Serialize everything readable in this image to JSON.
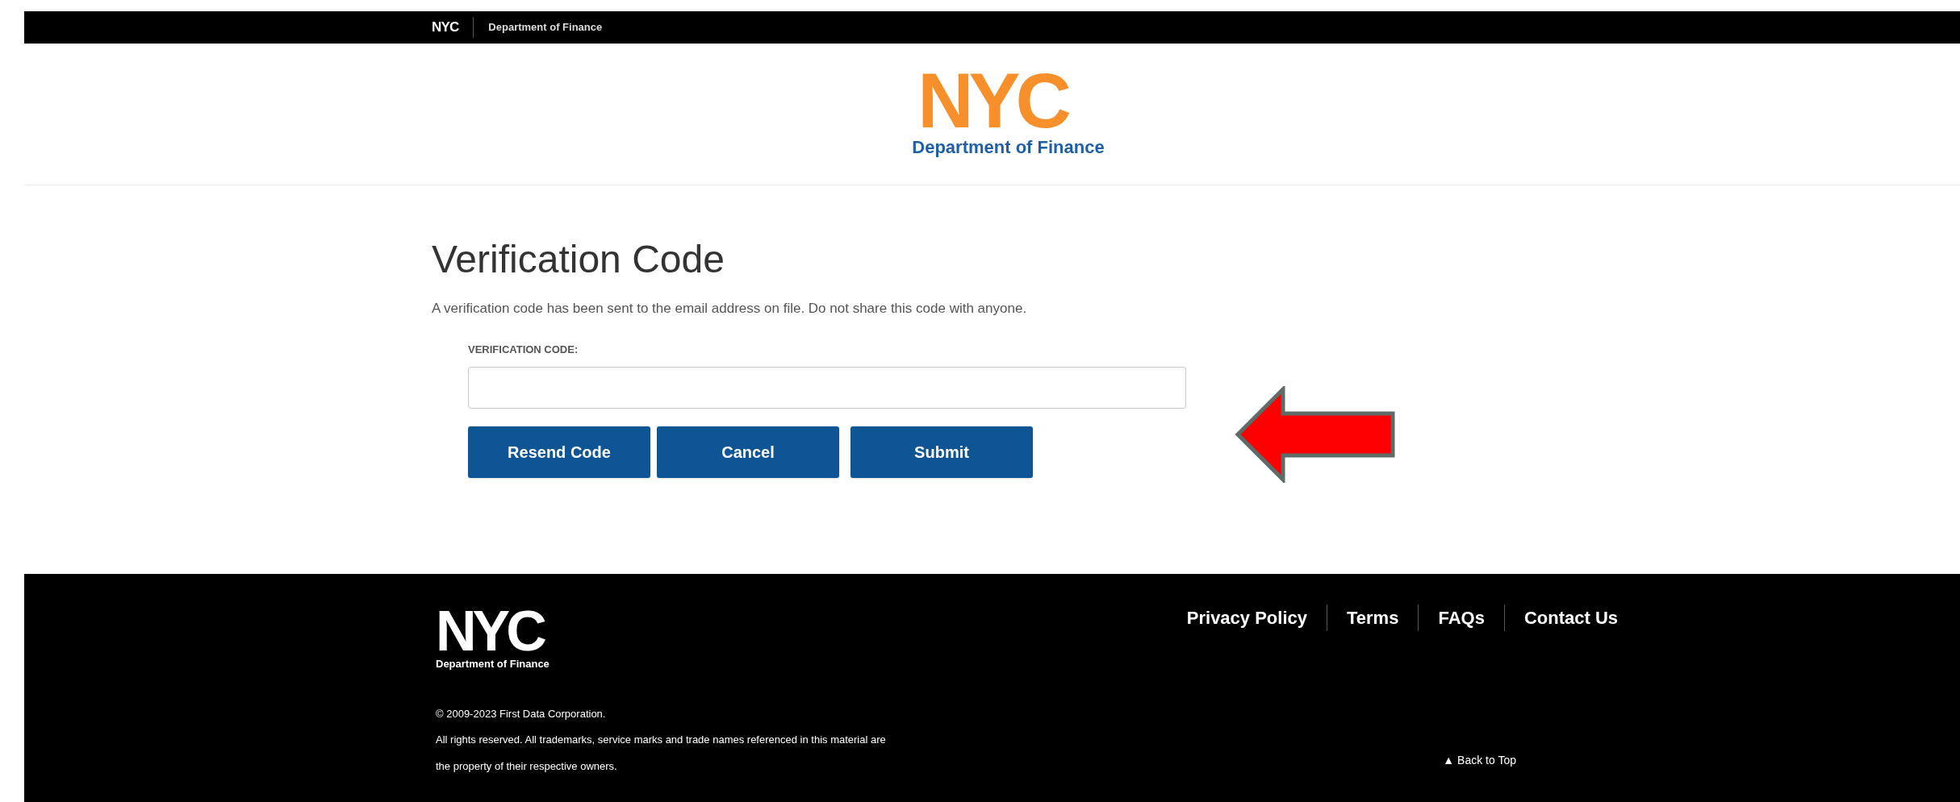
{
  "top_bar": {
    "logo": "NYC",
    "agency": "Department of Finance"
  },
  "header": {
    "logo": "NYC",
    "agency": "Department of Finance"
  },
  "form": {
    "title": "Verification Code",
    "message": "A verification code has been sent to the email address on file. Do not share this code with anyone.",
    "field": {
      "label": "VERIFICATION CODE:"
    },
    "buttons": [
      "Resend Code",
      "Cancel",
      "Submit"
    ]
  },
  "annotation": {
    "kind": "arrow",
    "color": "#ff0000"
  },
  "footer": {
    "logo": "NYC",
    "agency": "Department of Finance",
    "links": [
      "Privacy Policy",
      "Terms",
      "FAQs",
      "Contact Us"
    ],
    "copyright": "© 2009-2023 First Data Corporation.",
    "rights": [
      "All rights reserved. All trademarks, service marks and trade names referenced in this material are",
      "the property of their respective owners."
    ],
    "back_to_top": "▲ Back to Top"
  }
}
